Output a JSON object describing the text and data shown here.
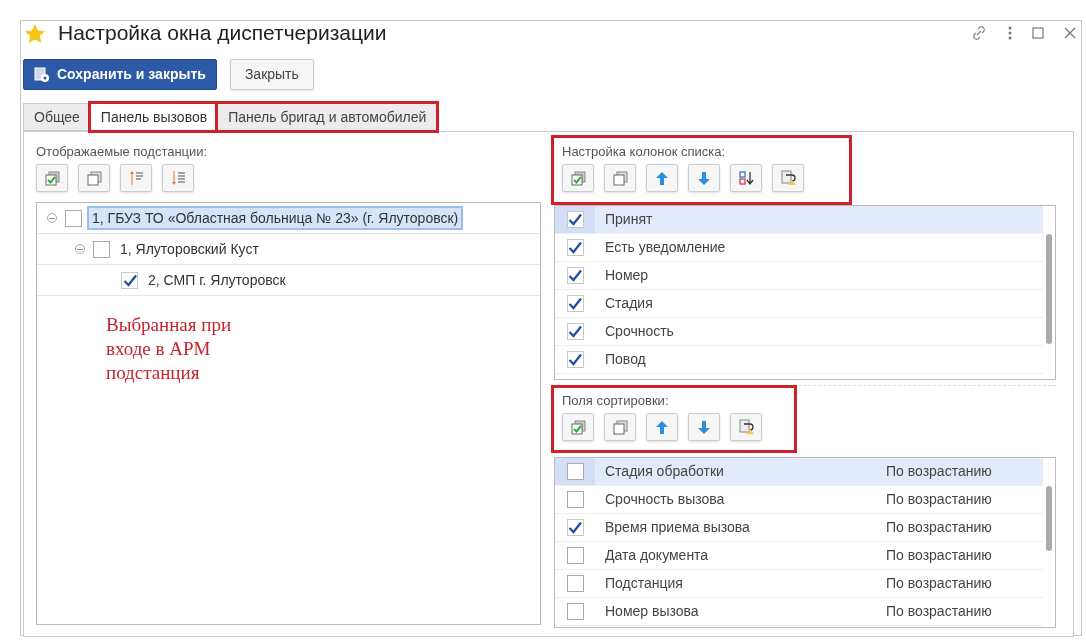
{
  "window": {
    "title": "Настройка окна диспетчеризации"
  },
  "buttons": [
    {
      "label": "Сохранить и закрыть",
      "kind": "primary"
    },
    {
      "label": "Закрыть",
      "kind": "default"
    }
  ],
  "tabs": [
    {
      "label": "Общее",
      "selected": false,
      "highlighted": false
    },
    {
      "label": "Панель вызовов",
      "selected": true,
      "highlighted": true
    },
    {
      "label": "Панель бригад и автомобилей",
      "selected": false,
      "highlighted": true
    }
  ],
  "substations": {
    "label": "Отображаемые подстанции:",
    "tree": [
      {
        "label": "1, ГБУЗ ТО «Областная больница № 23» (г. Ялуторовск)",
        "checked": false,
        "expanded": true,
        "selected": true,
        "children": [
          {
            "label": "1, Ялуторовский Куст",
            "checked": false,
            "expanded": true,
            "selected": false,
            "children": [
              {
                "label": "2, СМП г. Ялуторовск",
                "checked": true,
                "selected": false
              }
            ]
          }
        ]
      }
    ]
  },
  "annotation": "Выбранная при\nвходе в АРМ\nподстанция",
  "column_settings": {
    "label": "Настройка колонок списка:",
    "highlighted": true,
    "items": [
      {
        "label": "Принят",
        "checked": true,
        "selected": true
      },
      {
        "label": "Есть уведомление",
        "checked": true,
        "selected": false
      },
      {
        "label": "Номер",
        "checked": true,
        "selected": false
      },
      {
        "label": "Стадия",
        "checked": true,
        "selected": false
      },
      {
        "label": "Срочность",
        "checked": true,
        "selected": false
      },
      {
        "label": "Повод",
        "checked": true,
        "selected": false
      }
    ]
  },
  "sort_fields": {
    "label": "Поля сортировки:",
    "highlighted": true,
    "items": [
      {
        "label": "Стадия обработки",
        "order": "По возрастанию",
        "checked": false,
        "selected": true
      },
      {
        "label": "Срочность вызова",
        "order": "По возрастанию",
        "checked": false,
        "selected": false
      },
      {
        "label": "Время приема вызова",
        "order": "По возрастанию",
        "checked": true,
        "selected": false
      },
      {
        "label": "Дата документа",
        "order": "По возрастанию",
        "checked": false,
        "selected": false
      },
      {
        "label": "Подстанция",
        "order": "По возрастанию",
        "checked": false,
        "selected": false
      },
      {
        "label": "Номер вызова",
        "order": "По возрастанию",
        "checked": false,
        "selected": false
      }
    ]
  }
}
